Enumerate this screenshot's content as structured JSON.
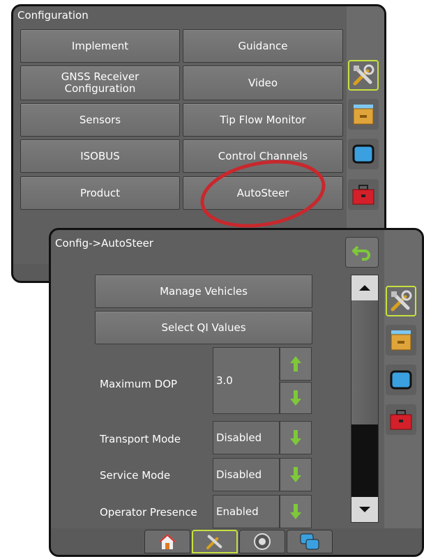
{
  "config_screen": {
    "title": "Configuration",
    "buttons": {
      "implement": "Implement",
      "guidance": "Guidance",
      "gnss": "GNSS Receiver Configuration",
      "video": "Video",
      "sensors": "Sensors",
      "tip_flow": "Tip Flow Monitor",
      "isobus": "ISOBUS",
      "control_channels": "Control Channels",
      "product": "Product",
      "autosteer": "AutoSteer"
    },
    "highlight_color": "#c8282d"
  },
  "autosteer_screen": {
    "title": "Config->AutoSteer",
    "manage_vehicles": "Manage Vehicles",
    "select_qi": "Select QI Values",
    "max_dop_label": "Maximum DOP",
    "max_dop_value": "3.0",
    "transport_label": "Transport Mode",
    "transport_value": "Disabled",
    "service_label": "Service Mode",
    "service_value": "Disabled",
    "operator_label": "Operator Presence",
    "operator_value": "Enabled"
  },
  "sidebar_icons": [
    "tools-icon",
    "storage-icon",
    "display-icon",
    "toolbox-icon"
  ],
  "footer_tabs": [
    "home-icon",
    "tools-icon",
    "guidance-icon",
    "screens-icon"
  ],
  "colors": {
    "accent_border": "#c8e040",
    "arrow_green": "#7ec83a",
    "toolbox_red": "#d4202a"
  }
}
